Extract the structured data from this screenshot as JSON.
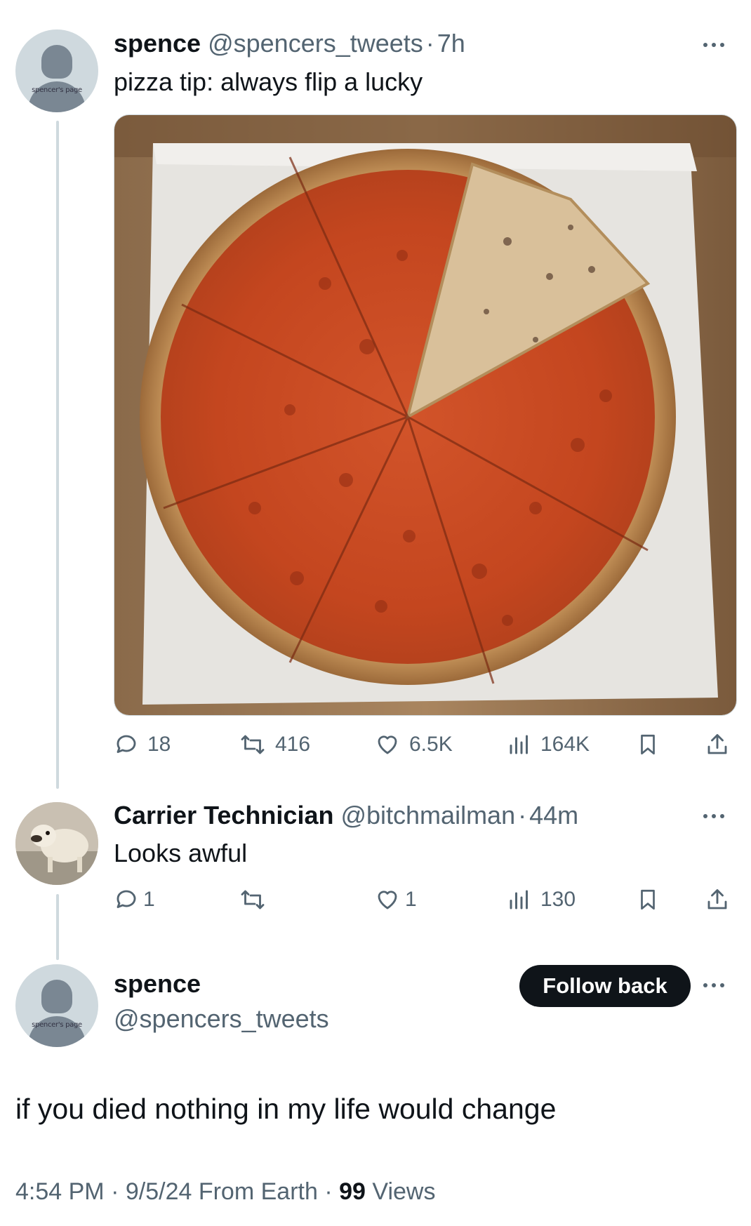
{
  "tweet1": {
    "name": "spence",
    "handle": "@spencers_tweets",
    "sep": "·",
    "time": "7h",
    "text": "pizza tip: always flip a lucky",
    "avatar_caption": "spencer's page",
    "image_alt": "pizza with one slice flipped upside down on parchment paper",
    "actions": {
      "replies": "18",
      "reposts": "416",
      "likes": "6.5K",
      "views": "164K"
    }
  },
  "reply": {
    "name": "Carrier Technician",
    "handle": "@bitchmailman",
    "sep": "·",
    "time": "44m",
    "text": "Looks awful",
    "actions": {
      "replies": "1",
      "reposts": "",
      "likes": "1",
      "views": "130"
    }
  },
  "tweet2": {
    "name": "spence",
    "handle": "@spencers_tweets",
    "avatar_caption": "spencer's page",
    "follow_label": "Follow back",
    "text": "if you died nothing in my life would change",
    "time": "4:54 PM",
    "date": "9/5/24",
    "source": "From Earth",
    "views_count": "99",
    "views_label": "Views"
  },
  "colors": {
    "muted": "#536471",
    "text": "#0f1419",
    "line": "#cfd9de",
    "button": "#0f1419"
  },
  "icons": [
    "reply-icon",
    "repost-icon",
    "like-icon",
    "views-icon",
    "bookmark-icon",
    "share-icon",
    "more-icon"
  ]
}
